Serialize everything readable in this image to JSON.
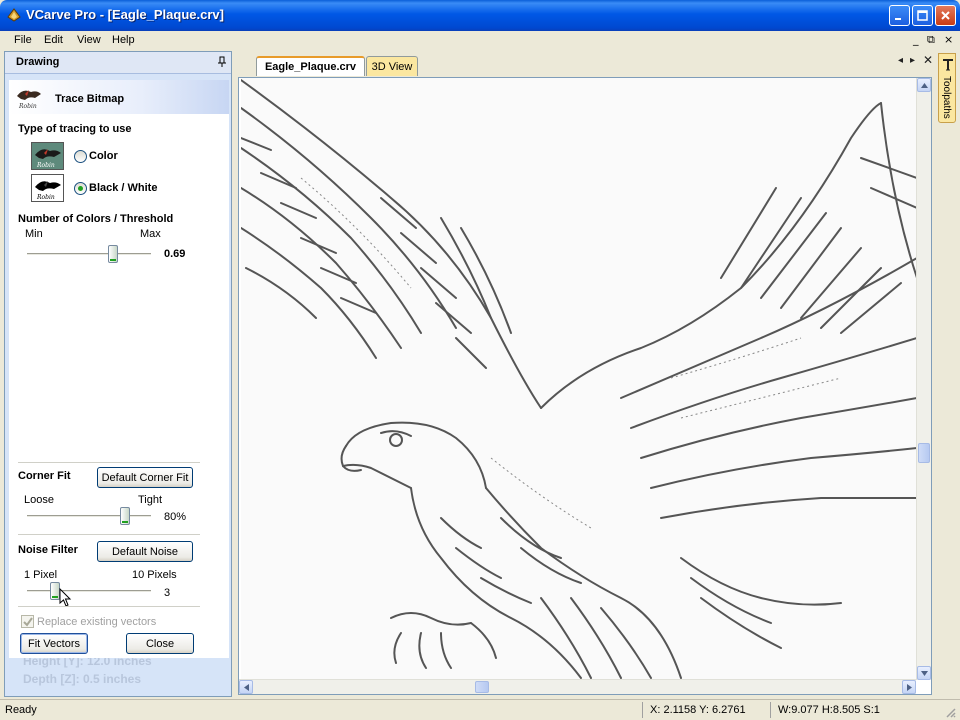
{
  "window": {
    "title": "VCarve Pro - [Eagle_Plaque.crv]"
  },
  "menu": {
    "items": [
      "File",
      "Edit",
      "View",
      "Help"
    ],
    "mdi_controls": [
      "_",
      "⧉",
      "×"
    ]
  },
  "drawing_panel": {
    "title": "Drawing",
    "section_title": "Trace Bitmap",
    "tracing_type": {
      "label": "Type of tracing to use",
      "options": [
        "Color",
        "Black / White"
      ],
      "selected": "Black / White"
    },
    "threshold": {
      "label": "Number of Colors / Threshold",
      "min_label": "Min",
      "max_label": "Max",
      "value_text": "0.69",
      "value": 0.69
    },
    "corner_fit": {
      "label": "Corner Fit",
      "button": "Default Corner Fit",
      "left_label": "Loose",
      "right_label": "Tight",
      "value_text": "80%",
      "value": 0.8
    },
    "noise_filter": {
      "label": "Noise Filter",
      "button": "Default Noise",
      "left_label": "1 Pixel",
      "right_label": "10 Pixels",
      "value_text": "3",
      "value": 3
    },
    "replace_vectors": {
      "label": "Replace existing vectors",
      "checked": true,
      "enabled": false
    },
    "fit_button": "Fit Vectors",
    "close_button": "Close",
    "behind_text": [
      "Height  [Y]: 12.0 inches",
      "Depth   [Z]: 0.5 inches"
    ]
  },
  "tabs": [
    {
      "label": "Eagle_Plaque.crv",
      "active": true
    },
    {
      "label": "3D View",
      "active": false
    }
  ],
  "right_tab": {
    "label": "Toolpaths"
  },
  "status": {
    "text": "Ready",
    "coords": "X: 2.1158 Y: 6.2761",
    "size": "W:9.077  H:8.505  S:1"
  },
  "colors": {
    "titlebar": "#0054e3",
    "tab_accent": "#e89b2a",
    "inactive_tab": "#fbe7a0",
    "panel_bg": "#d6e4f8"
  }
}
